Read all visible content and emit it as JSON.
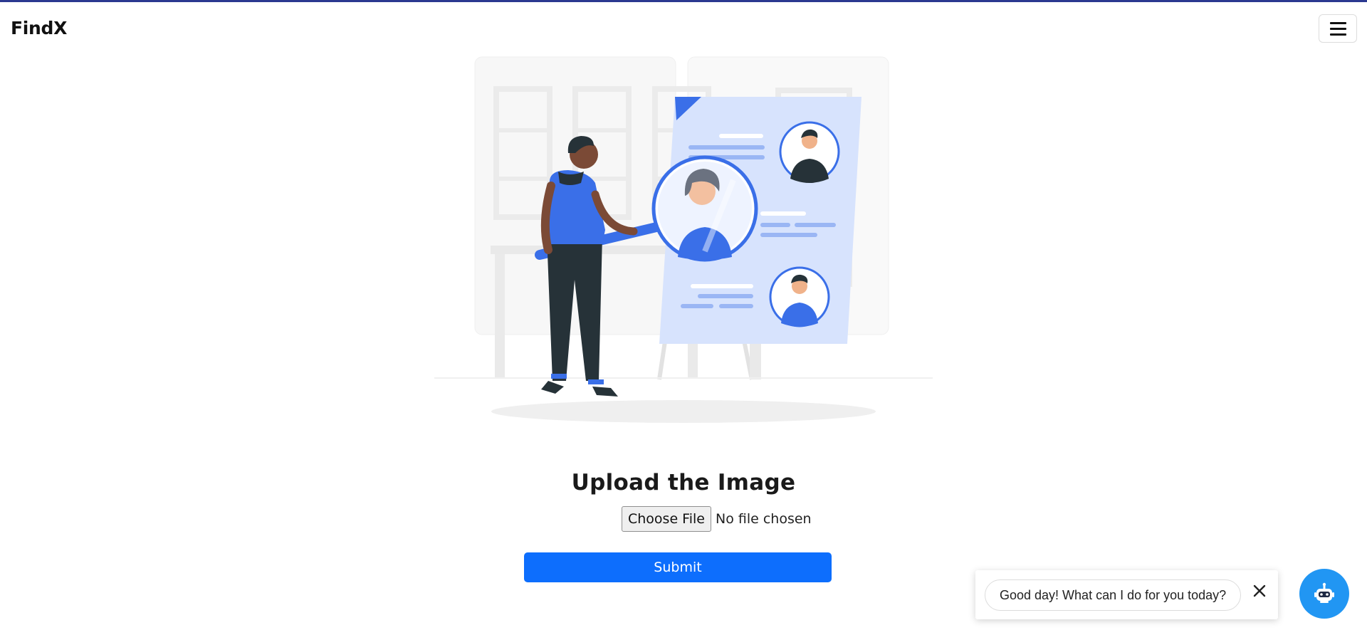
{
  "navbar": {
    "brand": "FindX",
    "menu_icon": "hamburger-menu-icon"
  },
  "hero": {
    "illustration": "person-with-magnifier-searching-candidate-profiles"
  },
  "upload": {
    "title": "Upload the Image",
    "choose_file_label": "Choose File",
    "file_status": "No file chosen",
    "submit_label": "Submit"
  },
  "chat": {
    "greeting": "Good day! What can I do for you today?",
    "close_icon": "close-icon",
    "launcher_icon": "robot-icon"
  },
  "colors": {
    "accent": "#0d6efd",
    "top_border": "#2b3990",
    "illustration_blue": "#3a6fe8",
    "chat_fab": "#2196f3"
  }
}
